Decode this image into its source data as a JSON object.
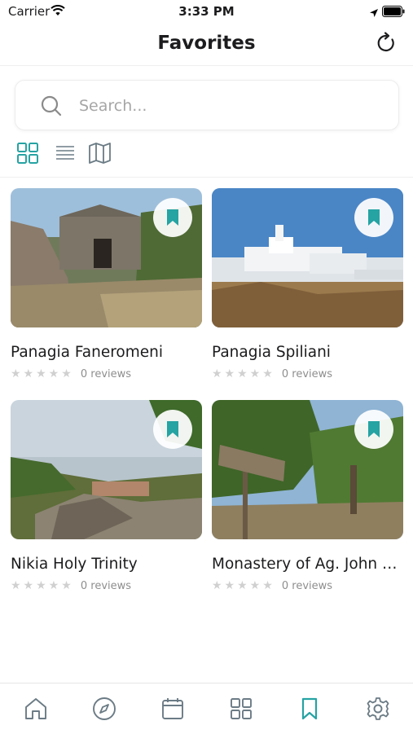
{
  "status": {
    "carrier": "Carrier",
    "time": "3:33 PM"
  },
  "header": {
    "title": "Favorites"
  },
  "search": {
    "placeholder": "Search..."
  },
  "colors": {
    "accent": "#26a3a3",
    "icon_gray": "#6b7b85"
  },
  "favorites": [
    {
      "name": "Panagia Faneromeni",
      "stars": "★★★★★",
      "reviews": "0 reviews"
    },
    {
      "name": "Panagia Spiliani",
      "stars": "★★★★★",
      "reviews": "0 reviews"
    },
    {
      "name": "Nikia Holy Trinity",
      "stars": "★★★★★",
      "reviews": "0 reviews"
    },
    {
      "name": "Monastery of Ag. John of...",
      "stars": "★★★★★",
      "reviews": "0 reviews"
    }
  ],
  "tabbar": {
    "items": [
      "home-icon",
      "compass-icon",
      "calendar-icon",
      "grid-icon",
      "bookmark-icon",
      "gear-icon"
    ],
    "active": "bookmark-icon"
  }
}
